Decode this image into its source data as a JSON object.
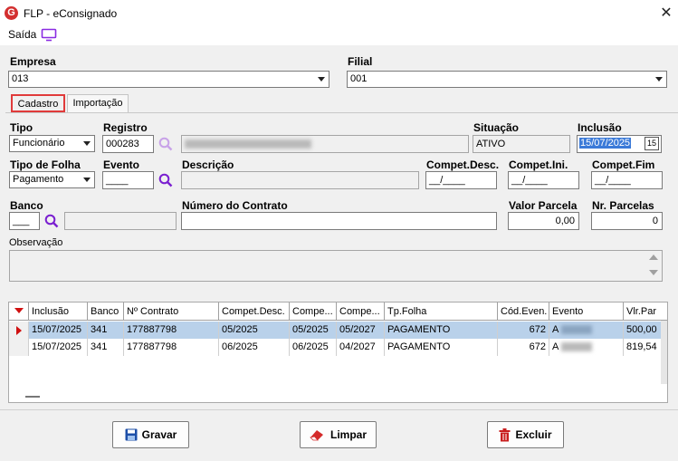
{
  "window": {
    "title": "FLP - eConsignado",
    "logo_letter": "G",
    "close_glyph": "✕"
  },
  "menu": {
    "saida_label": "Saída"
  },
  "empresa": {
    "label": "Empresa",
    "value": "013"
  },
  "filial": {
    "label": "Filial",
    "value": "001"
  },
  "tabs": [
    {
      "label": "Cadastro"
    },
    {
      "label": "Importação"
    }
  ],
  "form": {
    "tipo": {
      "label": "Tipo",
      "value": "Funcionário"
    },
    "registro": {
      "label": "Registro",
      "value": "000283"
    },
    "situacao": {
      "label": "Situação",
      "value": "ATIVO"
    },
    "inclusao": {
      "label": "Inclusão",
      "value": "15/07/2025",
      "cal_glyph": "15"
    },
    "tipo_folha": {
      "label": "Tipo de Folha",
      "value": "Pagamento"
    },
    "evento": {
      "label": "Evento",
      "value": "____"
    },
    "descricao": {
      "label": "Descrição",
      "value": ""
    },
    "compet_desc": {
      "label": "Compet.Desc.",
      "value": "__/____"
    },
    "compet_ini": {
      "label": "Compet.Ini.",
      "value": "__/____"
    },
    "compet_fim": {
      "label": "Compet.Fim",
      "value": "__/____"
    },
    "banco": {
      "label": "Banco",
      "value": "___"
    },
    "numero_contrato": {
      "label": "Número do Contrato",
      "value": ""
    },
    "valor_parcela": {
      "label": "Valor Parcela",
      "value": "0,00"
    },
    "nr_parcelas": {
      "label": "Nr. Parcelas",
      "value": "0"
    },
    "observacao": {
      "label": "Observação",
      "value": ""
    }
  },
  "grid": {
    "columns": [
      "Inclusão",
      "Banco",
      "Nº Contrato",
      "Compet.Desc.",
      "Compe...",
      "Compe...",
      "Tp.Folha",
      "Cód.Even.",
      "Evento",
      "Vlr.Par"
    ],
    "rows": [
      {
        "inclusao": "15/07/2025",
        "banco": "341",
        "contrato": "177887798",
        "compet_desc": "05/2025",
        "compet_ini": "05/2025",
        "compet_fim": "05/2027",
        "tp_folha": "PAGAMENTO",
        "cod_even": "672",
        "evento": "A",
        "vlr": "500,00",
        "selected": true
      },
      {
        "inclusao": "15/07/2025",
        "banco": "341",
        "contrato": "177887798",
        "compet_desc": "06/2025",
        "compet_ini": "06/2025",
        "compet_fim": "04/2027",
        "tp_folha": "PAGAMENTO",
        "cod_even": "672",
        "evento": "A",
        "vlr": "819,54",
        "selected": false
      }
    ]
  },
  "buttons": {
    "gravar": "Gravar",
    "limpar": "Limpar",
    "excluir": "Excluir"
  },
  "colors": {
    "accent_purple": "#8a2be2",
    "selected_row": "#b9d1ea",
    "tab_highlight": "#e03a3a",
    "logo_red": "#d32f2f"
  }
}
